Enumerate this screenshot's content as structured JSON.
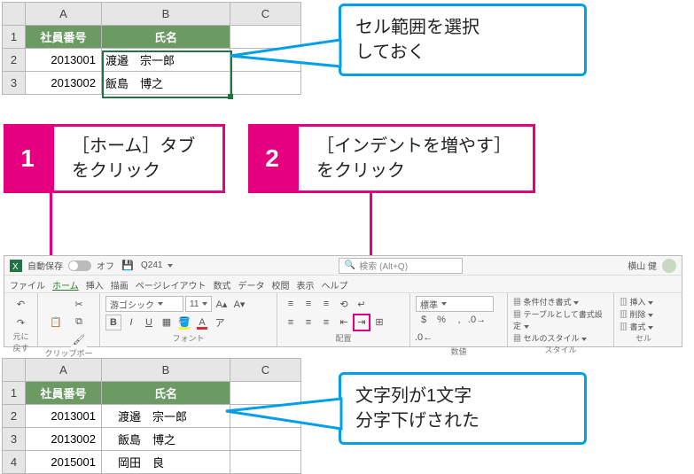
{
  "callouts": {
    "top": "セル範囲を選択\nしておく",
    "bottom": "文字列が1文字\n分字下げされた"
  },
  "steps": {
    "s1": {
      "num": "1",
      "text": "［ホーム］タブ\nをクリック"
    },
    "s2": {
      "num": "2",
      "text": "［インデントを増やす］\nをクリック"
    }
  },
  "sheet_top": {
    "cols": [
      "A",
      "B",
      "C"
    ],
    "header": {
      "a": "社員番号",
      "b": "氏名"
    },
    "rows": [
      {
        "n": "1"
      },
      {
        "n": "2",
        "a": "2013001",
        "b": "渡邉　宗一郎"
      },
      {
        "n": "3",
        "a": "2013002",
        "b": "飯島　博之"
      }
    ]
  },
  "sheet_bottom": {
    "cols": [
      "A",
      "B",
      "C"
    ],
    "header": {
      "a": "社員番号",
      "b": "氏名"
    },
    "rows": [
      {
        "n": "1"
      },
      {
        "n": "2",
        "a": "2013001",
        "b": "渡邉　宗一郎"
      },
      {
        "n": "3",
        "a": "2013002",
        "b": "飯島　博之"
      },
      {
        "n": "4",
        "a": "2015001",
        "b": "岡田　良"
      }
    ]
  },
  "ribbon": {
    "titlebar": {
      "autosave_label": "自動保存",
      "off_label": "オフ",
      "doc": "Q241",
      "search_placeholder": "検索 (Alt+Q)",
      "user": "横山 健"
    },
    "tabs": {
      "file": "ファイル",
      "home": "ホーム",
      "insert": "挿入",
      "draw": "描画",
      "layout": "ページレイアウト",
      "formulas": "数式",
      "data": "データ",
      "review": "校閲",
      "view": "表示",
      "help": "ヘルプ"
    },
    "groups": {
      "undo": "元に戻す",
      "clipboard": "クリップボード",
      "font_lbl": "フォント",
      "align": "配置",
      "number": "数値",
      "styles": "スタイル",
      "cells": "セル"
    },
    "font": {
      "name": "游ゴシック",
      "size": "11"
    },
    "number_fmt": "標準",
    "styles_items": {
      "cond": "条件付き書式",
      "table": "テーブルとして書式設定",
      "cell": "セルのスタイル"
    },
    "cells_items": {
      "insert": "挿入",
      "delete": "削除",
      "format": "書式"
    },
    "indent_increase_name": "increase-indent-button"
  }
}
